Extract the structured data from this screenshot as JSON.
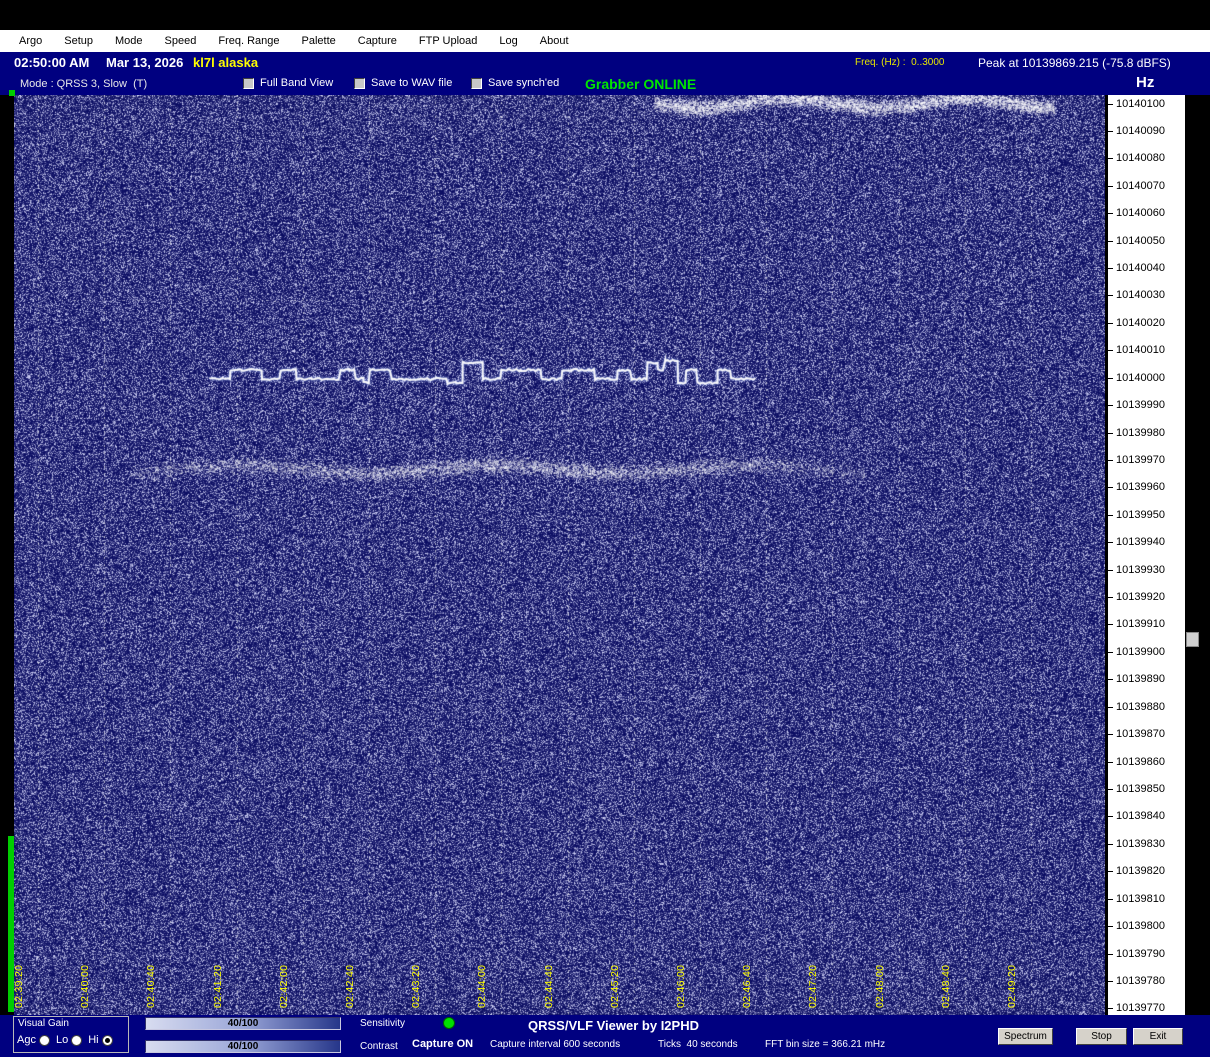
{
  "menubar": {
    "items": [
      "Argo",
      "Setup",
      "Mode",
      "Speed",
      "Freq. Range",
      "Palette",
      "Capture",
      "FTP Upload",
      "Log",
      "About"
    ]
  },
  "status": {
    "time": "02:50:00 AM",
    "date": "Mar 13, 2026",
    "callsign": "kl7l alaska",
    "freq_hz": "Freq. (Hz) :  0..3000",
    "peak": "Peak at 10139869.215 (-75.8 dBFS)"
  },
  "mode_row": {
    "mode_label": "Mode : QRSS 3, Slow  (T)",
    "checkboxes": [
      "Full Band View",
      "Save to WAV file",
      "Save synch'ed"
    ],
    "grabber_status": "Grabber ONLINE",
    "hz_label": "Hz"
  },
  "spectrogram": {
    "time_labels": [
      "02:39:20",
      "02:40:00",
      "02:40:40",
      "02:41:20",
      "02:42:00",
      "02:42:40",
      "02:43:20",
      "02:44:00",
      "02:44:40",
      "02:45:20",
      "02:46:00",
      "02:46:40",
      "02:47:20",
      "02:48:00",
      "02:48:40",
      "02:49:20"
    ],
    "freq_labels": [
      "10140100",
      "10140090",
      "10140080",
      "10140070",
      "10140060",
      "10140050",
      "10140040",
      "10140030",
      "10140020",
      "10140010",
      "10140000",
      "10139990",
      "10139980",
      "10139970",
      "10139960",
      "10139950",
      "10139940",
      "10139930",
      "10139920",
      "10139910",
      "10139900",
      "10139890",
      "10139880",
      "10139870",
      "10139860",
      "10139850",
      "10139840",
      "10139830",
      "10139820",
      "10139810",
      "10139800",
      "10139790",
      "10139780",
      "10139770"
    ]
  },
  "bottom_bar": {
    "visual_gain": {
      "title": "Visual Gain",
      "options": [
        "Agc",
        "Lo",
        "Hi"
      ],
      "selected": "Hi"
    },
    "sliders": [
      {
        "value": "40/100",
        "label": "Sensitivity"
      },
      {
        "value": "40/100",
        "label": "Contrast"
      }
    ],
    "capture_status": "Capture ON",
    "capture_interval": "Capture interval 600 seconds",
    "app_title": "QRSS/VLF Viewer by I2PHD",
    "ticks": "Ticks  40 seconds",
    "fft": "FFT bin size = 366.21 mHz",
    "buttons": [
      "Spectrum",
      "Stop",
      "Exit"
    ]
  },
  "colors": {
    "window_navy": "#000080",
    "menu_bg": "#ffffff",
    "label_yellow": "#ffff00",
    "online_green": "#00e600",
    "meter_green": "#00cc00"
  }
}
